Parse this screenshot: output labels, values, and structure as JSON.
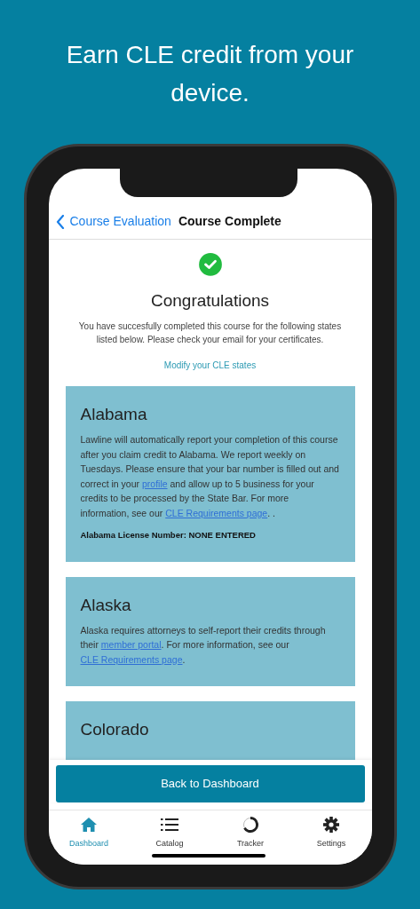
{
  "headline": "Earn CLE credit from your device.",
  "nav": {
    "back_label": "Course Evaluation",
    "title": "Course Complete"
  },
  "heading": "Congratulations",
  "message": "You have succesfully completed this course for the following states listed below. Please check your email for your certificates.",
  "modify_link": "Modify your CLE states",
  "states": [
    {
      "name": "Alabama",
      "body": [
        {
          "kind": "text",
          "text": "Lawline will automatically report your completion of this course after you claim credit to Alabama. We report weekly on Tuesdays. Please ensure that your bar number is filled out and correct in your "
        },
        {
          "kind": "link",
          "text": "profile"
        },
        {
          "kind": "text",
          "text": " and allow up to 5 business for your credits to be processed by the State Bar.  For more information, see our "
        },
        {
          "kind": "link",
          "text": "CLE Requirements page"
        },
        {
          "kind": "text",
          "text": ".  ."
        }
      ],
      "license": "Alabama License Number: NONE ENTERED"
    },
    {
      "name": "Alaska",
      "body": [
        {
          "kind": "text",
          "text": "Alaska requires attorneys to self-report their credits through their "
        },
        {
          "kind": "link",
          "text": "member portal"
        },
        {
          "kind": "text",
          "text": ". For more information, see our "
        },
        {
          "kind": "link",
          "text": "CLE Requirements page"
        },
        {
          "kind": "text",
          "text": "."
        }
      ]
    },
    {
      "name": "Colorado"
    }
  ],
  "primary_button": "Back to Dashboard",
  "tabs": [
    {
      "label": "Dashboard",
      "kind": "home",
      "selected": true
    },
    {
      "label": "Catalog",
      "kind": "list",
      "selected": false
    },
    {
      "label": "Tracker",
      "kind": "ring",
      "selected": false
    },
    {
      "label": "Settings",
      "kind": "gear",
      "selected": false
    }
  ]
}
